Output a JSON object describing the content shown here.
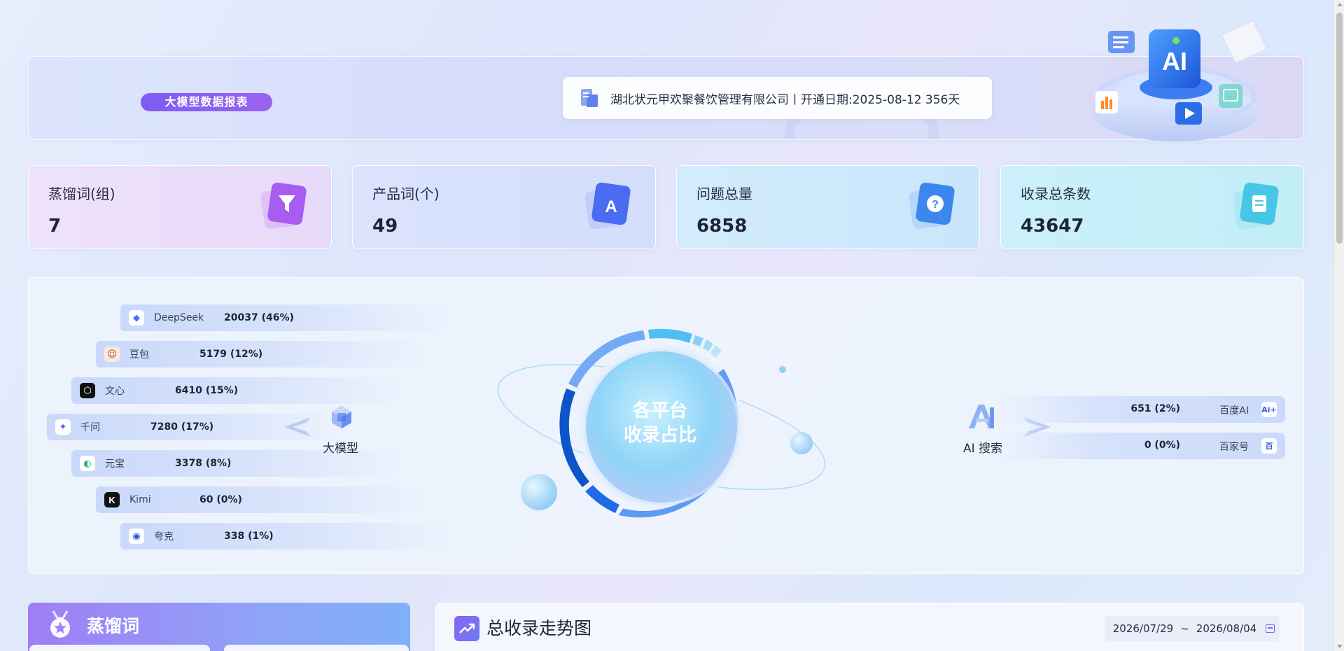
{
  "header": {
    "report_label": "大模型数据报表",
    "company_info": "湖北状元甲欢聚餐饮管理有限公司丨开通日期:2025-08-12 356天",
    "illustration_text": "AI"
  },
  "stats": [
    {
      "label": "蒸馏词(组)",
      "value": "7",
      "icon": "funnel-icon",
      "color": "#9b5cf0"
    },
    {
      "label": "产品词(个)",
      "value": "49",
      "icon": "letter-a-icon",
      "color": "#4f6ef0"
    },
    {
      "label": "问题总量",
      "value": "6858",
      "icon": "question-icon",
      "color": "#3d8ff0"
    },
    {
      "label": "收录总条数",
      "value": "43647",
      "icon": "document-icon",
      "color": "#3cc3e0"
    }
  ],
  "platform": {
    "center_title_line1": "各平台",
    "center_title_line2": "收录占比",
    "big_model_label": "大模型",
    "ai_search_label": "AI 搜索",
    "llms": [
      {
        "name": "DeepSeek",
        "value": "20037 (46%)",
        "icon": "deepseek-icon"
      },
      {
        "name": "豆包",
        "value": "5179 (12%)",
        "icon": "doubao-icon"
      },
      {
        "name": "文心",
        "value": "6410 (15%)",
        "icon": "wenxin-icon"
      },
      {
        "name": "千问",
        "value": "7280 (17%)",
        "icon": "qianwen-icon"
      },
      {
        "name": "元宝",
        "value": "3378 (8%)",
        "icon": "yuanbao-icon"
      },
      {
        "name": "Kimi",
        "value": "60 (0%)",
        "icon": "kimi-icon"
      },
      {
        "name": "夸克",
        "value": "338 (1%)",
        "icon": "quark-icon"
      }
    ],
    "ai_search": [
      {
        "name": "百度AI",
        "value": "651 (2%)",
        "icon": "baidu-ai-icon",
        "logo_text": "Ai+"
      },
      {
        "name": "百家号",
        "value": "0 (0%)",
        "icon": "baijiahao-icon",
        "logo_text": "百"
      }
    ]
  },
  "distill_card": {
    "title": "蒸馏词"
  },
  "trend_card": {
    "title": "总收录走势图",
    "date_start": "2026/07/29",
    "date_sep": "~",
    "date_end": "2026/08/04"
  }
}
